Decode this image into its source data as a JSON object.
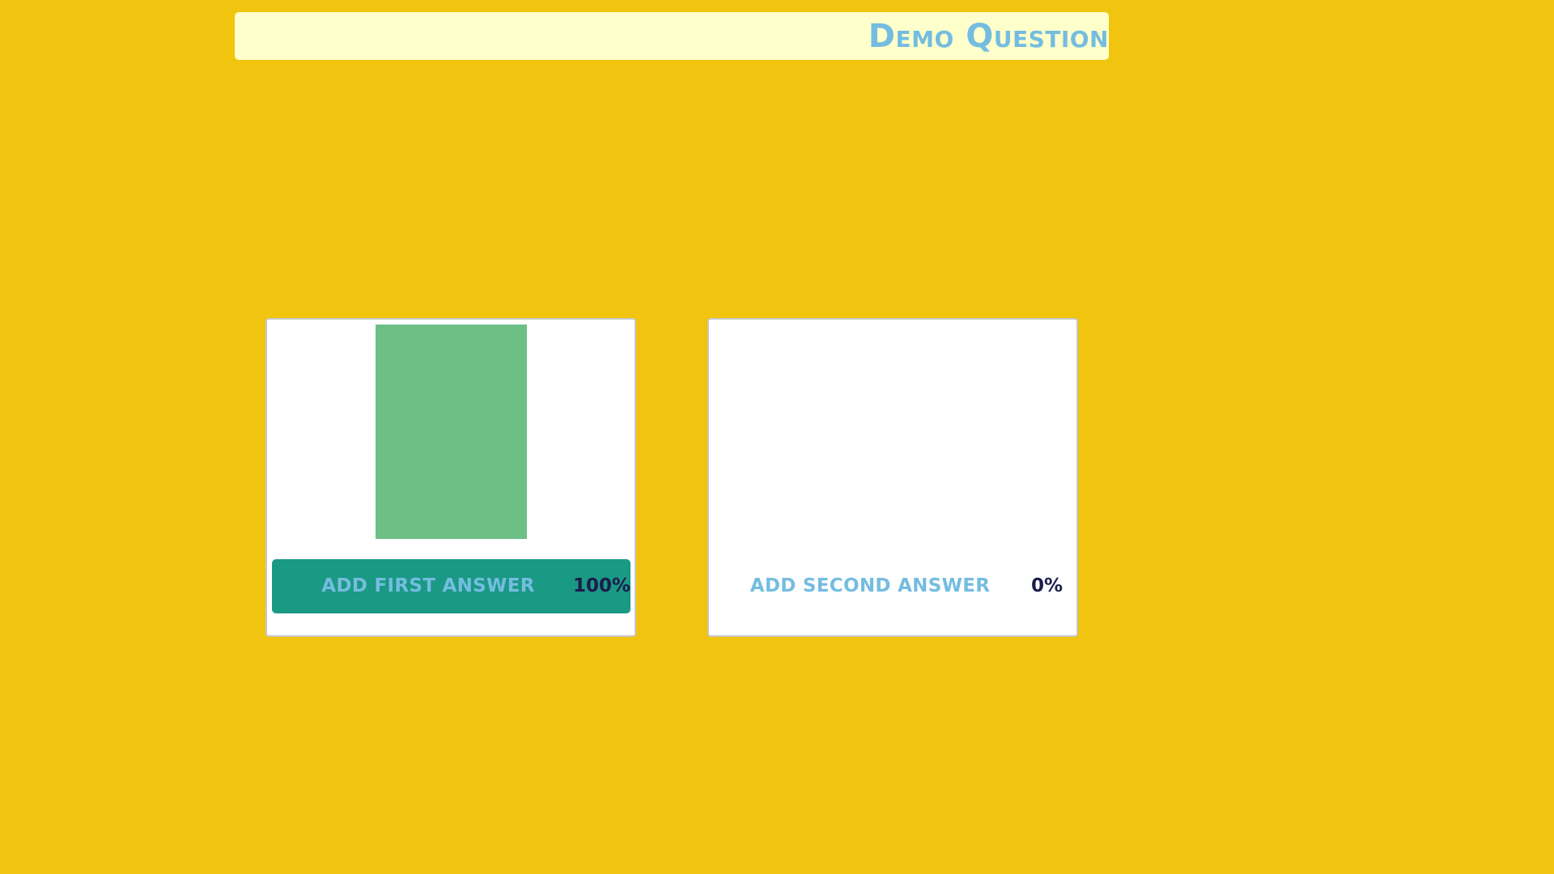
{
  "question": {
    "title": "Demo Question"
  },
  "answers": [
    {
      "label": "Add first answer",
      "percent_label": "100%",
      "percent": 100,
      "bar_color": "#6dbf86",
      "button_color": "#1a9984"
    },
    {
      "label": "Add second answer",
      "percent_label": "0%",
      "percent": 0,
      "bar_color": "#6dbf86",
      "button_color": "#ffffff"
    }
  ],
  "colors": {
    "background": "#f1c40f",
    "question_bar": "#ffffcc",
    "accent_text": "#74bde0",
    "percent_text": "#1c1c4a"
  }
}
